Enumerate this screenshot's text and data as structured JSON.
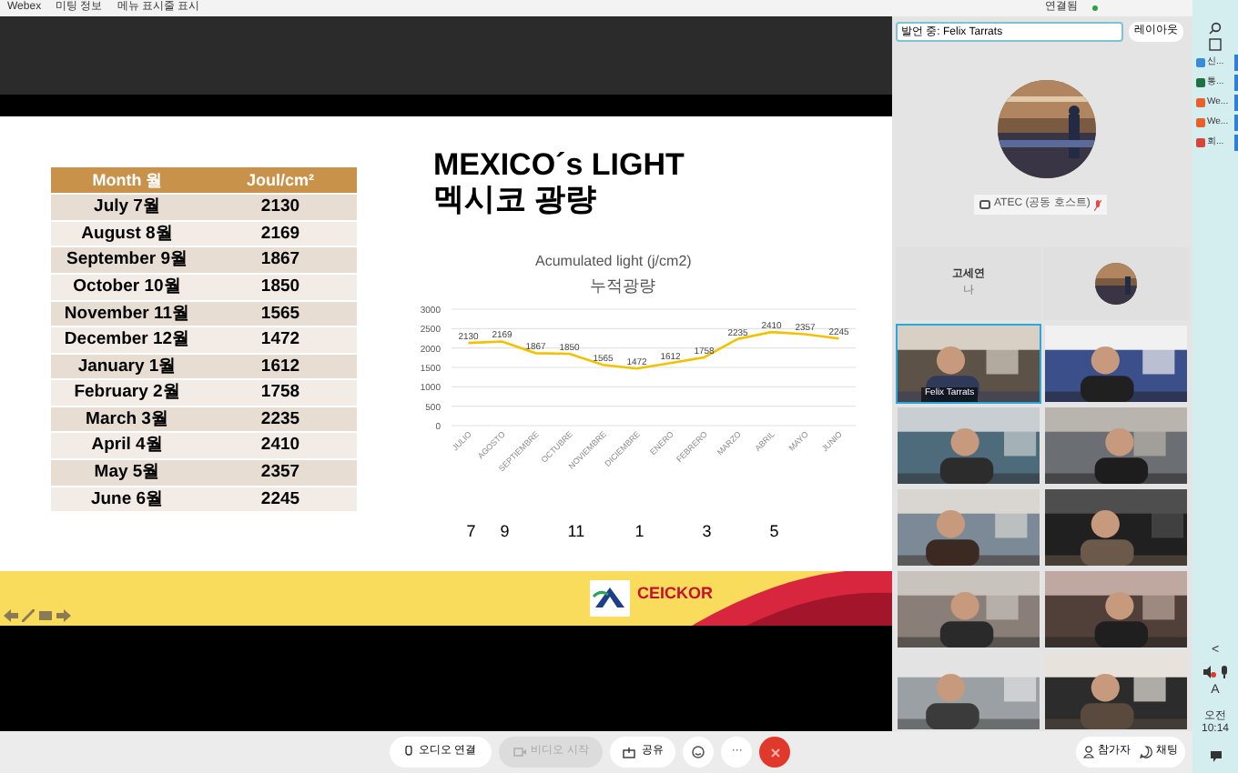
{
  "titlebar": {
    "app": "Webex",
    "meeting_info": "미팅 정보",
    "menu_toggle": "메뉴 표시줄 표시",
    "status": "연결됨"
  },
  "slide": {
    "title": "MEXICO´s LIGHT",
    "subtitle": "멕시코 광량",
    "table": {
      "columns": [
        "Month 월",
        "Joul/cm²"
      ],
      "rows": [
        [
          "July 7월",
          "2130"
        ],
        [
          "August 8월",
          "2169"
        ],
        [
          "September 9월",
          "1867"
        ],
        [
          "October 10월",
          "1850"
        ],
        [
          "November 11월",
          "1565"
        ],
        [
          "December 12월",
          "1472"
        ],
        [
          "January 1월",
          "1612"
        ],
        [
          "February 2월",
          "1758"
        ],
        [
          "March 3월",
          "2235"
        ],
        [
          "April 4월",
          "2410"
        ],
        [
          "May 5월",
          "2357"
        ],
        [
          "June 6월",
          "2245"
        ]
      ]
    },
    "chart_data": {
      "type": "line",
      "title": "Acumulated light (j/cm2)\n누적광량",
      "categories": [
        "JULIO",
        "AGOSTO",
        "SEPTIEMBRE",
        "OCTUBRE",
        "NOVIEMBRE",
        "DICIEMBRE",
        "ENERO",
        "FEBRERO",
        "MARZO",
        "ABRIL",
        "MAYO",
        "JUNIO"
      ],
      "series": [
        {
          "color": "#f2c200",
          "values": [
            2130,
            2169,
            1867,
            1850,
            1565,
            1472,
            1612,
            1758,
            2235,
            2410,
            2357,
            2245
          ]
        }
      ],
      "ylim": [
        0,
        3000
      ],
      "yticks": [
        0,
        500,
        1000,
        1500,
        2000,
        2500,
        3000
      ],
      "data_labels": true,
      "grid": true
    },
    "month_numbers": [
      "7",
      "9",
      "11",
      "1",
      "3",
      "5"
    ],
    "logo_text": "CEICKOR"
  },
  "speaker_field": {
    "value": "발언 중: Felix Tarrats"
  },
  "layout_button": "레이아웃",
  "host": {
    "label": "ATEC (공동 호스트)"
  },
  "self_tile": {
    "name": "고세연",
    "sub": "나"
  },
  "video_tiles": [
    {
      "name": "Felix Tarrats",
      "selected": true
    },
    {
      "selected": false
    },
    {
      "selected": false
    },
    {
      "selected": false
    },
    {
      "selected": false
    },
    {
      "selected": false
    },
    {
      "selected": false
    },
    {
      "selected": false
    },
    {
      "selected": false
    },
    {
      "selected": false
    }
  ],
  "toolbar": {
    "audio": "오디오 연결",
    "video": "비디오 시작",
    "share": "공유",
    "more": "···",
    "participants": "참가자",
    "chat": "채팅"
  },
  "taskbar": {
    "items": [
      "신...",
      "통...",
      "We...",
      "We...",
      "회..."
    ],
    "expand": "<",
    "input": "A",
    "time": "오전 10:14"
  }
}
